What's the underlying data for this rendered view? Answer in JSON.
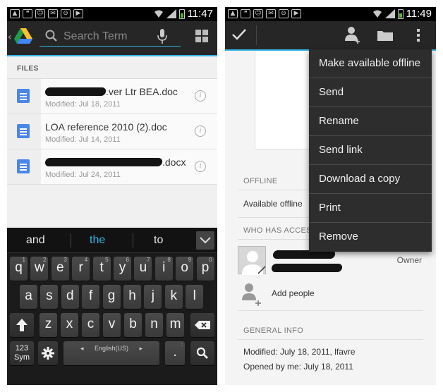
{
  "left_screen": {
    "status_bar": {
      "time": "11:47"
    },
    "app_bar": {
      "search_placeholder": "Search Term"
    },
    "section_label": "FILES",
    "files": [
      {
        "name_visible": ".ver Ltr BEA.doc",
        "modified": "Modified: Jul 18, 2011"
      },
      {
        "name_visible": "LOA reference 2010 (2).doc",
        "modified": "Modified: Jul 14, 2011"
      },
      {
        "name_visible": ".docx",
        "modified": "Modified: Jul 24, 2011"
      }
    ],
    "keyboard": {
      "suggestions": [
        "and",
        "the",
        "to"
      ],
      "row1": [
        {
          "k": "q",
          "s": "1"
        },
        {
          "k": "w",
          "s": "2"
        },
        {
          "k": "e",
          "s": "3"
        },
        {
          "k": "r",
          "s": "4"
        },
        {
          "k": "t",
          "s": "5"
        },
        {
          "k": "y",
          "s": "6"
        },
        {
          "k": "u",
          "s": "7"
        },
        {
          "k": "i",
          "s": "8"
        },
        {
          "k": "o",
          "s": "9"
        },
        {
          "k": "p",
          "s": "0"
        }
      ],
      "row2": [
        "a",
        "s",
        "d",
        "f",
        "g",
        "h",
        "j",
        "k",
        "l"
      ],
      "row3": [
        "z",
        "x",
        "c",
        "v",
        "b",
        "n",
        "m"
      ],
      "sym_label": "123\nSym",
      "space_label": "English(US)",
      "period_label": ".",
      "period_alt": ":"
    }
  },
  "right_screen": {
    "status_bar": {
      "time": "11:49"
    },
    "menu": [
      "Make available offline",
      "Send",
      "Rename",
      "Send link",
      "Download a copy",
      "Print",
      "Remove"
    ],
    "offline": {
      "label": "OFFLINE",
      "value": "Available offline"
    },
    "access": {
      "label": "WHO HAS ACCESS",
      "owner_role": "Owner",
      "add_people": "Add people"
    },
    "general": {
      "label": "GENERAL INFO",
      "modified": "Modified: July 18, 2011, lfavre",
      "opened": "Opened by me: July 18, 2011"
    }
  },
  "colors": {
    "accent": "#33b5e5",
    "bar": "#262626",
    "menu_bg": "#2d2d2d",
    "doc_blue": "#4a86e8"
  }
}
